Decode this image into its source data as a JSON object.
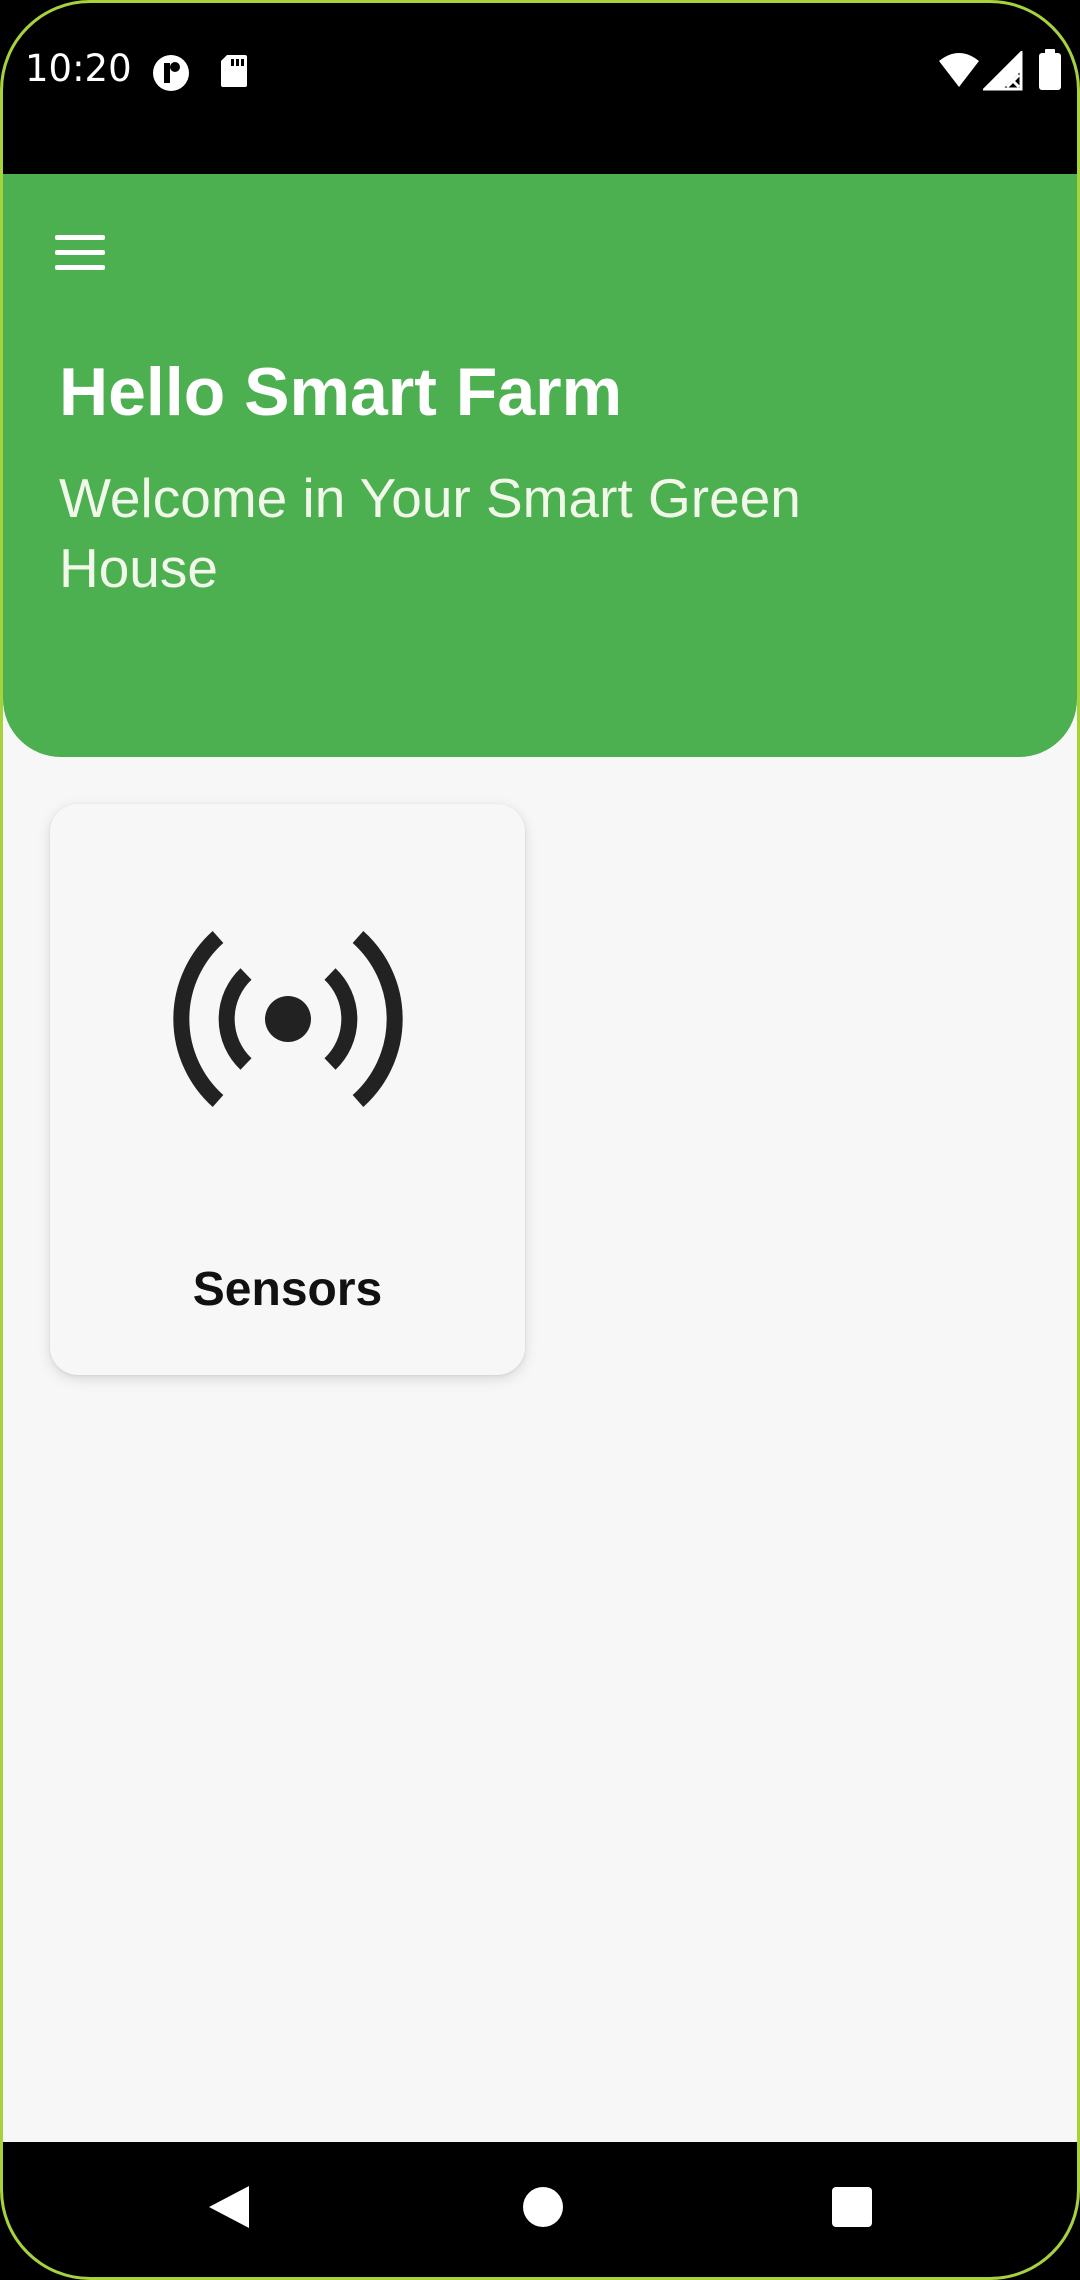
{
  "status_bar": {
    "time": "10:20",
    "icons": [
      "app-notification-icon",
      "sd-card-icon",
      "wifi-icon",
      "signal-no-service-icon",
      "battery-icon"
    ]
  },
  "header": {
    "menu_icon": "hamburger-menu-icon",
    "title": "Hello Smart Farm",
    "subtitle": "Welcome in Your Smart Green House",
    "background_color": "#4caf50"
  },
  "cards": [
    {
      "label": "Sensors",
      "icon": "sensors-broadcast-icon"
    }
  ],
  "navigation": {
    "back_icon": "back-triangle-icon",
    "home_icon": "home-circle-icon",
    "recents_icon": "recents-square-icon"
  }
}
